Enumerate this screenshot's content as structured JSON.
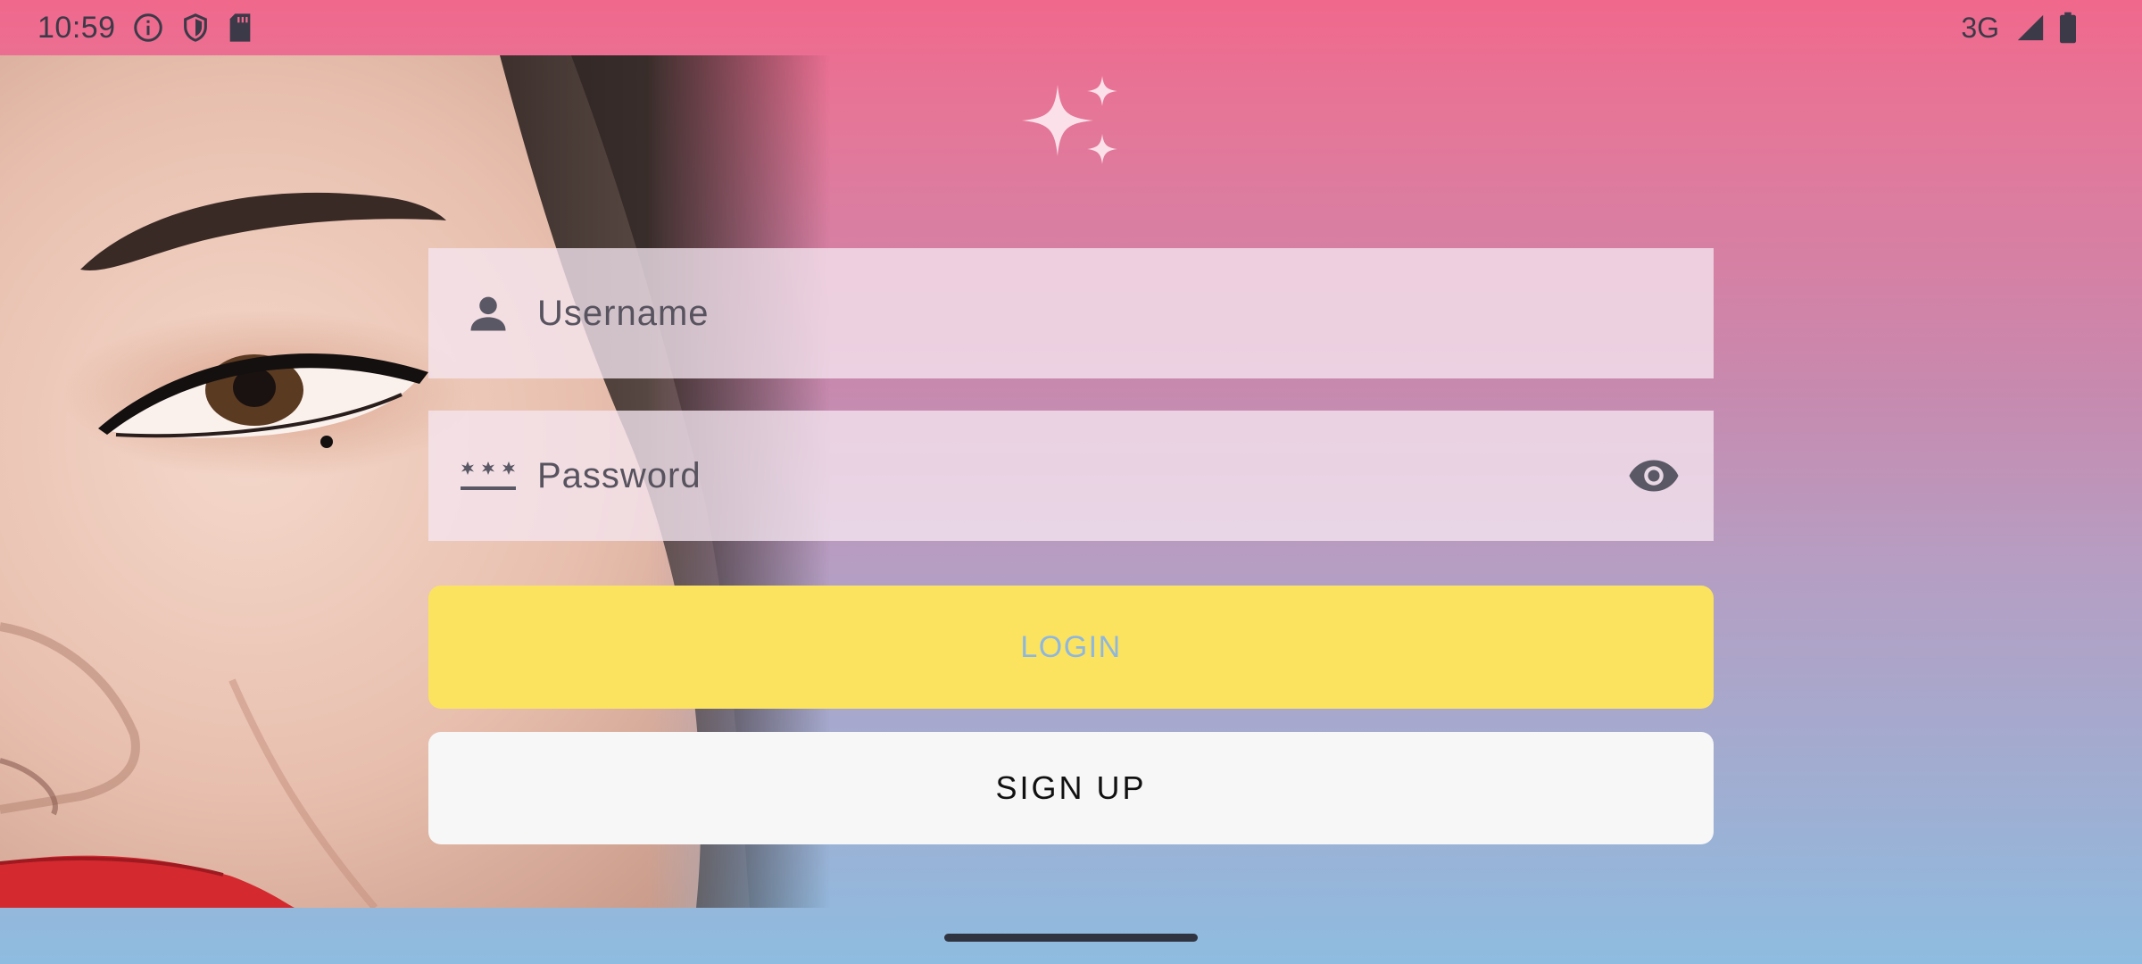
{
  "status_bar": {
    "time": "10:59",
    "network": "3G",
    "icons_left": [
      "info-icon",
      "shield-icon",
      "sd-card-icon"
    ],
    "icons_right": [
      "signal-icon",
      "battery-icon"
    ]
  },
  "logo": {
    "icon": "sparkles-icon",
    "color": "#fbe0ea"
  },
  "form": {
    "username": {
      "placeholder": "Username",
      "value": "",
      "icon": "person-icon"
    },
    "password": {
      "placeholder": "Password",
      "value": "",
      "icon": "password-icon",
      "toggle_icon": "eye-icon"
    }
  },
  "buttons": {
    "login_label": "LOGIN",
    "signup_label": "SIGN UP"
  },
  "colors": {
    "gradient_top": "#f0688c",
    "gradient_bottom": "#8ebce0",
    "login_bg": "#fbe360",
    "login_text": "#8fb7de",
    "signup_bg": "#f7f7f7"
  }
}
